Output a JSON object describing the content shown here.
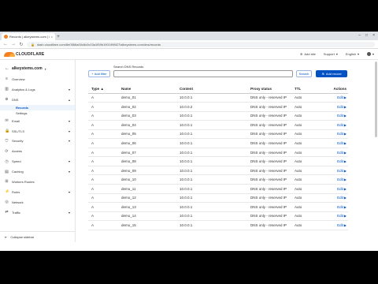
{
  "browser": {
    "tab_title": "Records | alkeystems.com | Cloudfla...",
    "tab_close": "×",
    "new_tab": "+",
    "window_controls": [
      "–",
      "□",
      "×"
    ],
    "url": "dash.cloudflare.com/8e0566a00c8c0c03a1f59b1901998f27/alkeystems.com/dns/records",
    "nav": [
      "←",
      "→",
      "↻"
    ]
  },
  "header": {
    "logo_text": "CLOUDFLARE",
    "search_placeholder": "",
    "add_site": "Add site",
    "support": "Support",
    "language": "English",
    "caret": "▾"
  },
  "sidebar": {
    "site_name": "alkeystems.com",
    "items": [
      {
        "icon": "list-icon",
        "glyph": "≡",
        "label": "Overview",
        "chevron": ""
      },
      {
        "icon": "chart-icon",
        "glyph": "▥",
        "label": "Analytics & Logs",
        "chevron": "▾"
      },
      {
        "icon": "dns-icon",
        "glyph": "⊕",
        "label": "DNS",
        "chevron": "▴"
      }
    ],
    "dns_sub": [
      {
        "label": "Records"
      },
      {
        "label": "Settings"
      }
    ],
    "items2": [
      {
        "icon": "email-icon",
        "glyph": "✉",
        "label": "Email",
        "chevron": "▾"
      },
      {
        "icon": "lock-icon",
        "glyph": "🔒",
        "label": "SSL/TLS",
        "chevron": "▾"
      },
      {
        "icon": "shield-icon",
        "glyph": "⛉",
        "label": "Security",
        "chevron": "▾"
      },
      {
        "icon": "access-icon",
        "glyph": "⟳",
        "label": "Access",
        "chevron": ""
      },
      {
        "icon": "speed-icon",
        "glyph": "◷",
        "label": "Speed",
        "chevron": "▾"
      },
      {
        "icon": "caching-icon",
        "glyph": "▤",
        "label": "Caching",
        "chevron": "▾"
      },
      {
        "icon": "workers-icon",
        "glyph": "⊞",
        "label": "Workers Routes",
        "chevron": ""
      },
      {
        "icon": "rules-icon",
        "glyph": "⚡",
        "label": "Rules",
        "chevron": "▾"
      },
      {
        "icon": "network-icon",
        "glyph": "◎",
        "label": "Network",
        "chevron": ""
      },
      {
        "icon": "traffic-icon",
        "glyph": "⇄",
        "label": "Traffic",
        "chevron": "▾"
      }
    ],
    "collapse_label": "Collapse sidebar"
  },
  "toolbar": {
    "add_filter": "Add filter",
    "search_label": "Search DNS Records",
    "search_button": "Search",
    "add_record": "Add record"
  },
  "table": {
    "headers": [
      "Type",
      "Name",
      "Content",
      "Proxy status",
      "TTL",
      "Actions"
    ],
    "sort_indicator": "▲",
    "rows": [
      {
        "type": "A",
        "name": "demo_01",
        "content": "10.0.0.1",
        "proxy": "DNS only - reserved IP",
        "ttl": "Auto",
        "action": "Edit"
      },
      {
        "type": "A",
        "name": "demo_02",
        "content": "10.0.0.2",
        "proxy": "DNS only - reserved IP",
        "ttl": "Auto",
        "action": "Edit"
      },
      {
        "type": "A",
        "name": "demo_03",
        "content": "10.0.0.1",
        "proxy": "DNS only - reserved IP",
        "ttl": "Auto",
        "action": "Edit"
      },
      {
        "type": "A",
        "name": "demo_04",
        "content": "10.0.0.1",
        "proxy": "DNS only - reserved IP",
        "ttl": "Auto",
        "action": "Edit"
      },
      {
        "type": "A",
        "name": "demo_05",
        "content": "10.0.0.1",
        "proxy": "DNS only - reserved IP",
        "ttl": "Auto",
        "action": "Edit"
      },
      {
        "type": "A",
        "name": "demo_06",
        "content": "10.0.0.1",
        "proxy": "DNS only - reserved IP",
        "ttl": "Auto",
        "action": "Edit"
      },
      {
        "type": "A",
        "name": "demo_07",
        "content": "10.0.0.1",
        "proxy": "DNS only - reserved IP",
        "ttl": "Auto",
        "action": "Edit"
      },
      {
        "type": "A",
        "name": "demo_08",
        "content": "10.0.0.1",
        "proxy": "DNS only - reserved IP",
        "ttl": "Auto",
        "action": "Edit"
      },
      {
        "type": "A",
        "name": "demo_09",
        "content": "10.0.0.1",
        "proxy": "DNS only - reserved IP",
        "ttl": "Auto",
        "action": "Edit"
      },
      {
        "type": "A",
        "name": "demo_10",
        "content": "10.0.0.1",
        "proxy": "DNS only - reserved IP",
        "ttl": "Auto",
        "action": "Edit"
      },
      {
        "type": "A",
        "name": "demo_11",
        "content": "10.0.0.1",
        "proxy": "DNS only - reserved IP",
        "ttl": "Auto",
        "action": "Edit"
      },
      {
        "type": "A",
        "name": "demo_12",
        "content": "10.0.0.1",
        "proxy": "DNS only - reserved IP",
        "ttl": "Auto",
        "action": "Edit"
      },
      {
        "type": "A",
        "name": "demo_13",
        "content": "10.0.0.1",
        "proxy": "DNS only - reserved IP",
        "ttl": "Auto",
        "action": "Edit"
      },
      {
        "type": "A",
        "name": "demo_14",
        "content": "10.0.0.1",
        "proxy": "DNS only - reserved IP",
        "ttl": "Auto",
        "action": "Edit"
      },
      {
        "type": "A",
        "name": "demo_15",
        "content": "10.0.0.1",
        "proxy": "DNS only - reserved IP",
        "ttl": "Auto",
        "action": "Edit"
      }
    ]
  },
  "colors": {
    "accent": "#0051c3",
    "brand_orange": "#f48120",
    "letterbox": "#000000"
  }
}
